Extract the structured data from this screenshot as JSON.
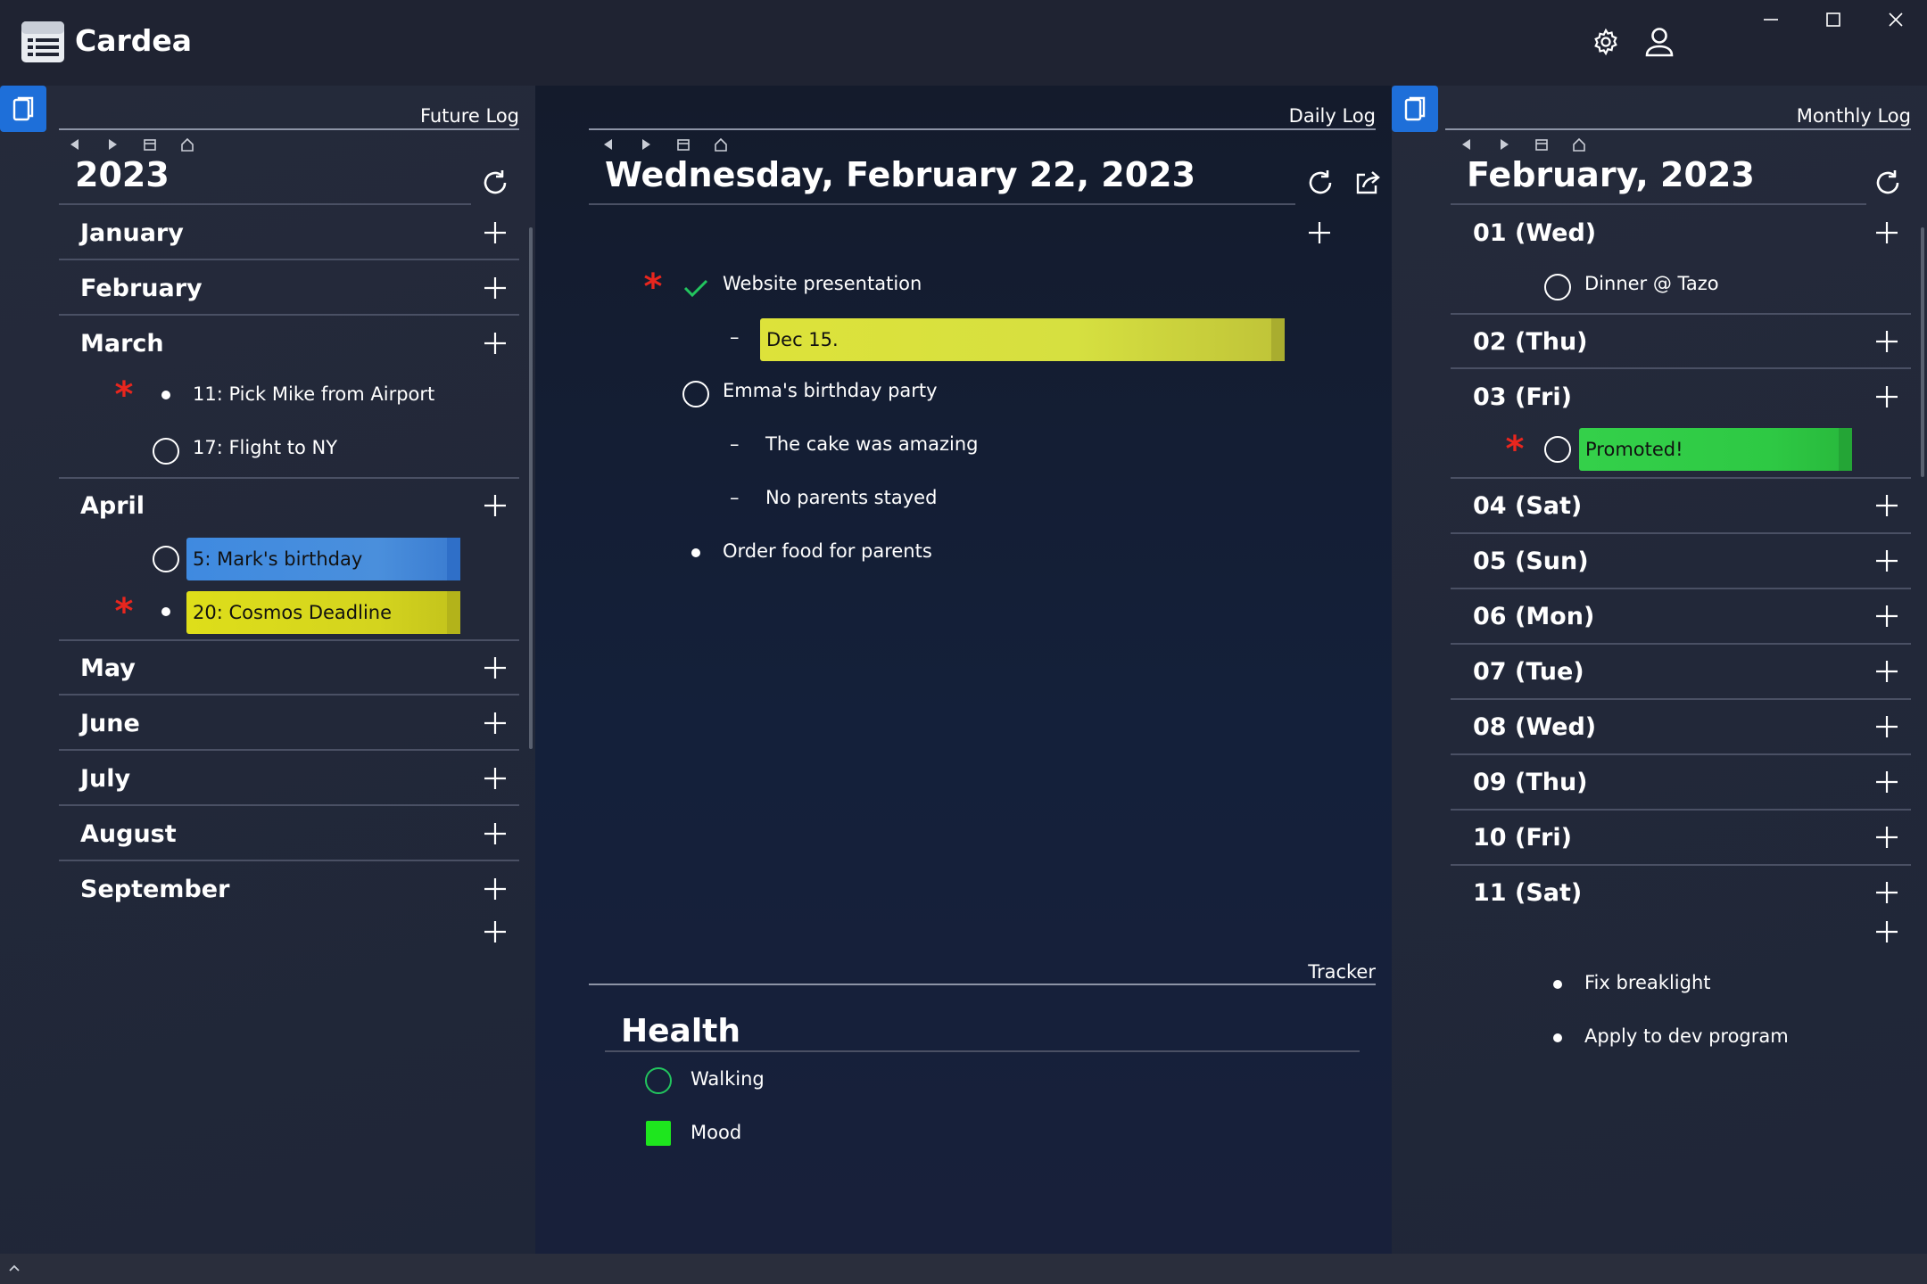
{
  "app": {
    "title": "Cardea"
  },
  "future_log": {
    "panel_label": "Future Log",
    "year": "2023",
    "months": [
      {
        "name": "January",
        "items": []
      },
      {
        "name": "February",
        "items": []
      },
      {
        "name": "March",
        "items": [
          {
            "text": "11: Pick Mike from Airport",
            "marker": "bullet",
            "priority": true
          },
          {
            "text": "17: Flight to NY",
            "marker": "circle",
            "priority": false
          }
        ]
      },
      {
        "name": "April",
        "items": [
          {
            "text": "5: Mark's birthday",
            "marker": "circle",
            "priority": false,
            "highlight": "#4a8fdc"
          },
          {
            "text": "20: Cosmos Deadline",
            "marker": "bullet",
            "priority": true,
            "highlight": "#d4d41e"
          }
        ]
      },
      {
        "name": "May",
        "items": []
      },
      {
        "name": "June",
        "items": []
      },
      {
        "name": "July",
        "items": []
      },
      {
        "name": "August",
        "items": []
      },
      {
        "name": "September",
        "items": []
      }
    ]
  },
  "daily_log": {
    "panel_label": "Daily Log",
    "date": "Wednesday, February 22, 2023",
    "entries": [
      {
        "text": "Website presentation",
        "marker": "check",
        "priority": true
      },
      {
        "text": "Dec 15.",
        "marker": "dash",
        "highlight": "#d6e040"
      },
      {
        "text": "Emma's birthday party",
        "marker": "circle"
      },
      {
        "text": "The cake was amazing",
        "marker": "dash"
      },
      {
        "text": "No parents stayed",
        "marker": "dash"
      },
      {
        "text": "Order food for parents",
        "marker": "bullet"
      }
    ]
  },
  "tracker": {
    "panel_label": "Tracker",
    "title": "Health",
    "items": [
      {
        "text": "Walking",
        "marker": "circle",
        "color": "#22c55e"
      },
      {
        "text": "Mood",
        "marker": "square",
        "color": "#1ee61e"
      }
    ]
  },
  "monthly_log": {
    "panel_label": "Monthly Log",
    "month": "February, 2023",
    "days": [
      {
        "label": "01 (Wed)",
        "items": [
          {
            "text": "Dinner @ Tazo",
            "marker": "circle"
          }
        ]
      },
      {
        "label": "02 (Thu)",
        "items": []
      },
      {
        "label": "03 (Fri)",
        "items": [
          {
            "text": "Promoted!",
            "marker": "circle",
            "priority": true,
            "highlight": "#2ec944"
          }
        ]
      },
      {
        "label": "04 (Sat)",
        "items": []
      },
      {
        "label": "05 (Sun)",
        "items": []
      },
      {
        "label": "06 (Mon)",
        "items": []
      },
      {
        "label": "07 (Tue)",
        "items": []
      },
      {
        "label": "08 (Wed)",
        "items": []
      },
      {
        "label": "09 (Thu)",
        "items": []
      },
      {
        "label": "10 (Fri)",
        "items": []
      },
      {
        "label": "11 (Sat)",
        "items": []
      }
    ],
    "backlog": [
      {
        "text": "Fix breaklight",
        "marker": "bullet"
      },
      {
        "text": "Apply to dev program",
        "marker": "bullet"
      }
    ]
  }
}
